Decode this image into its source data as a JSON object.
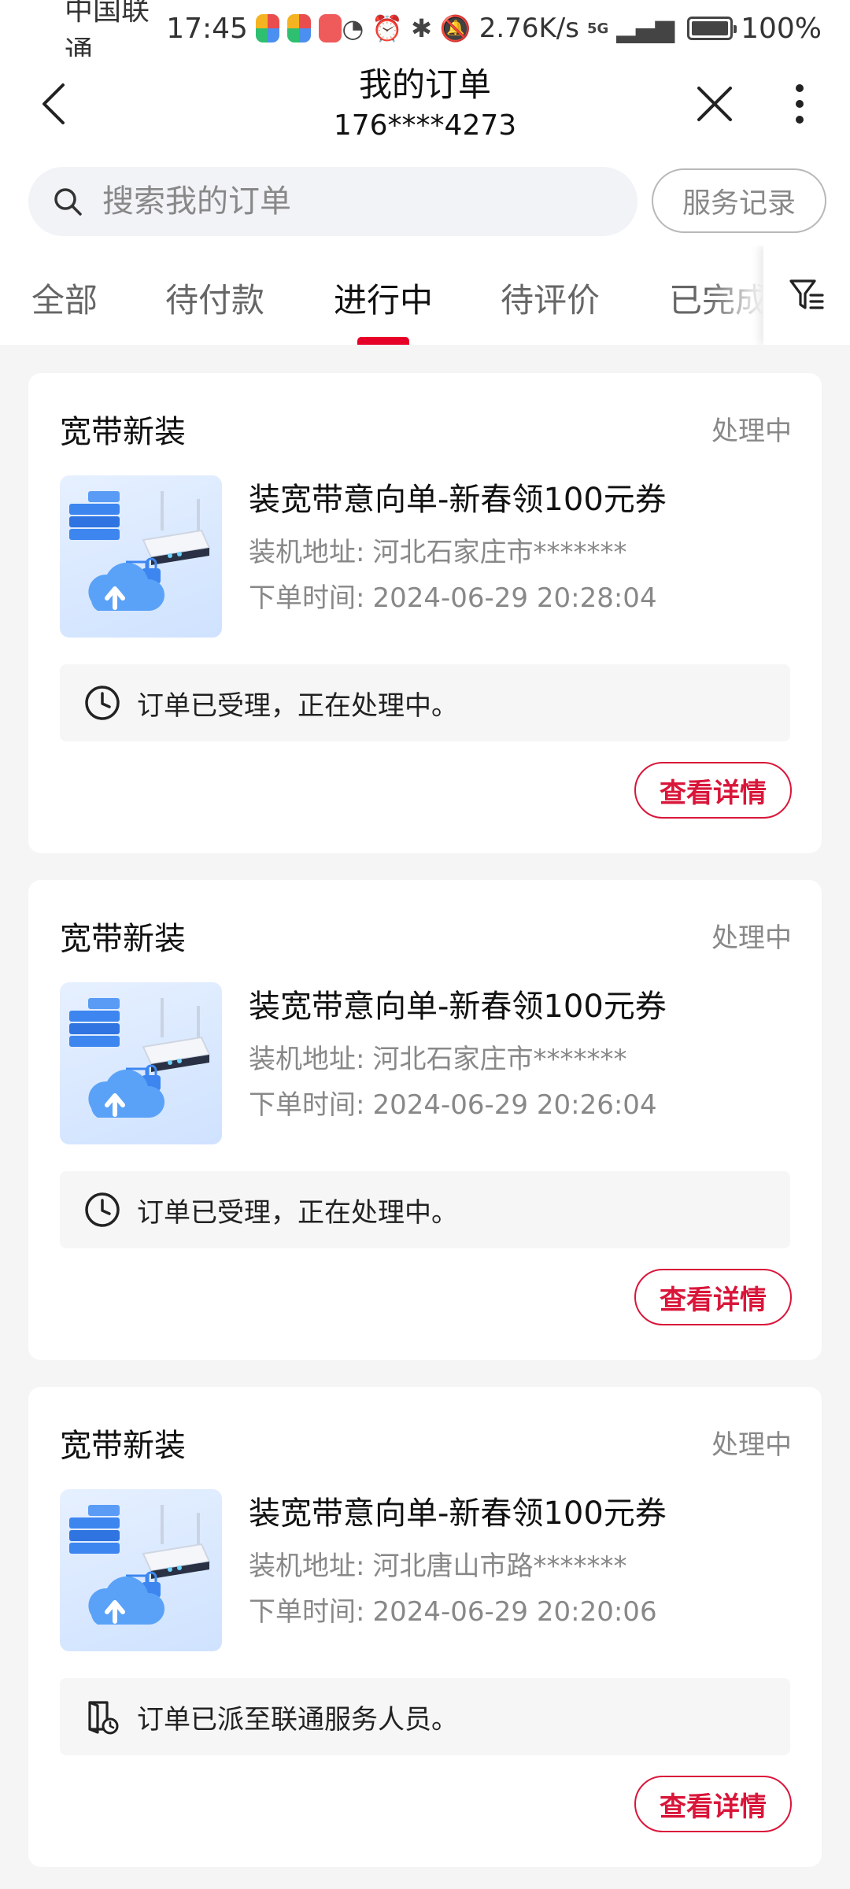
{
  "status_bar": {
    "carrier": "中国联通",
    "time": "17:45",
    "speed": "2.76K/s",
    "network": "5G",
    "battery": "100%"
  },
  "nav": {
    "title": "我的订单",
    "subtitle": "176****4273"
  },
  "search": {
    "placeholder": "搜索我的订单",
    "service_button": "服务记录"
  },
  "tabs": [
    {
      "label": "全部"
    },
    {
      "label": "待付款"
    },
    {
      "label": "进行中"
    },
    {
      "label": "待评价"
    },
    {
      "label": "已完成"
    }
  ],
  "active_tab_index": 2,
  "orders": [
    {
      "type": "宽带新装",
      "status": "处理中",
      "title": "装宽带意向单-新春领100元券",
      "address_label": "装机地址:",
      "address": "河北石家庄市*******",
      "time_label": "下单时间:",
      "time": "2024-06-29 20:28:04",
      "notice_icon": "clock-icon",
      "notice": "订单已受理，正在处理中。",
      "detail_button": "查看详情"
    },
    {
      "type": "宽带新装",
      "status": "处理中",
      "title": "装宽带意向单-新春领100元券",
      "address_label": "装机地址:",
      "address": "河北石家庄市*******",
      "time_label": "下单时间:",
      "time": "2024-06-29 20:26:04",
      "notice_icon": "clock-icon",
      "notice": "订单已受理，正在处理中。",
      "detail_button": "查看详情"
    },
    {
      "type": "宽带新装",
      "status": "处理中",
      "title": "装宽带意向单-新春领100元券",
      "address_label": "装机地址:",
      "address": "河北唐山市路*******",
      "time_label": "下单时间:",
      "time": "2024-06-29 20:20:06",
      "notice_icon": "dispatch-icon",
      "notice": "订单已派至联通服务人员。",
      "detail_button": "查看详情"
    }
  ],
  "colors": {
    "accent": "#e60027",
    "button_text": "#d9163a",
    "background": "#f5f5f5"
  }
}
